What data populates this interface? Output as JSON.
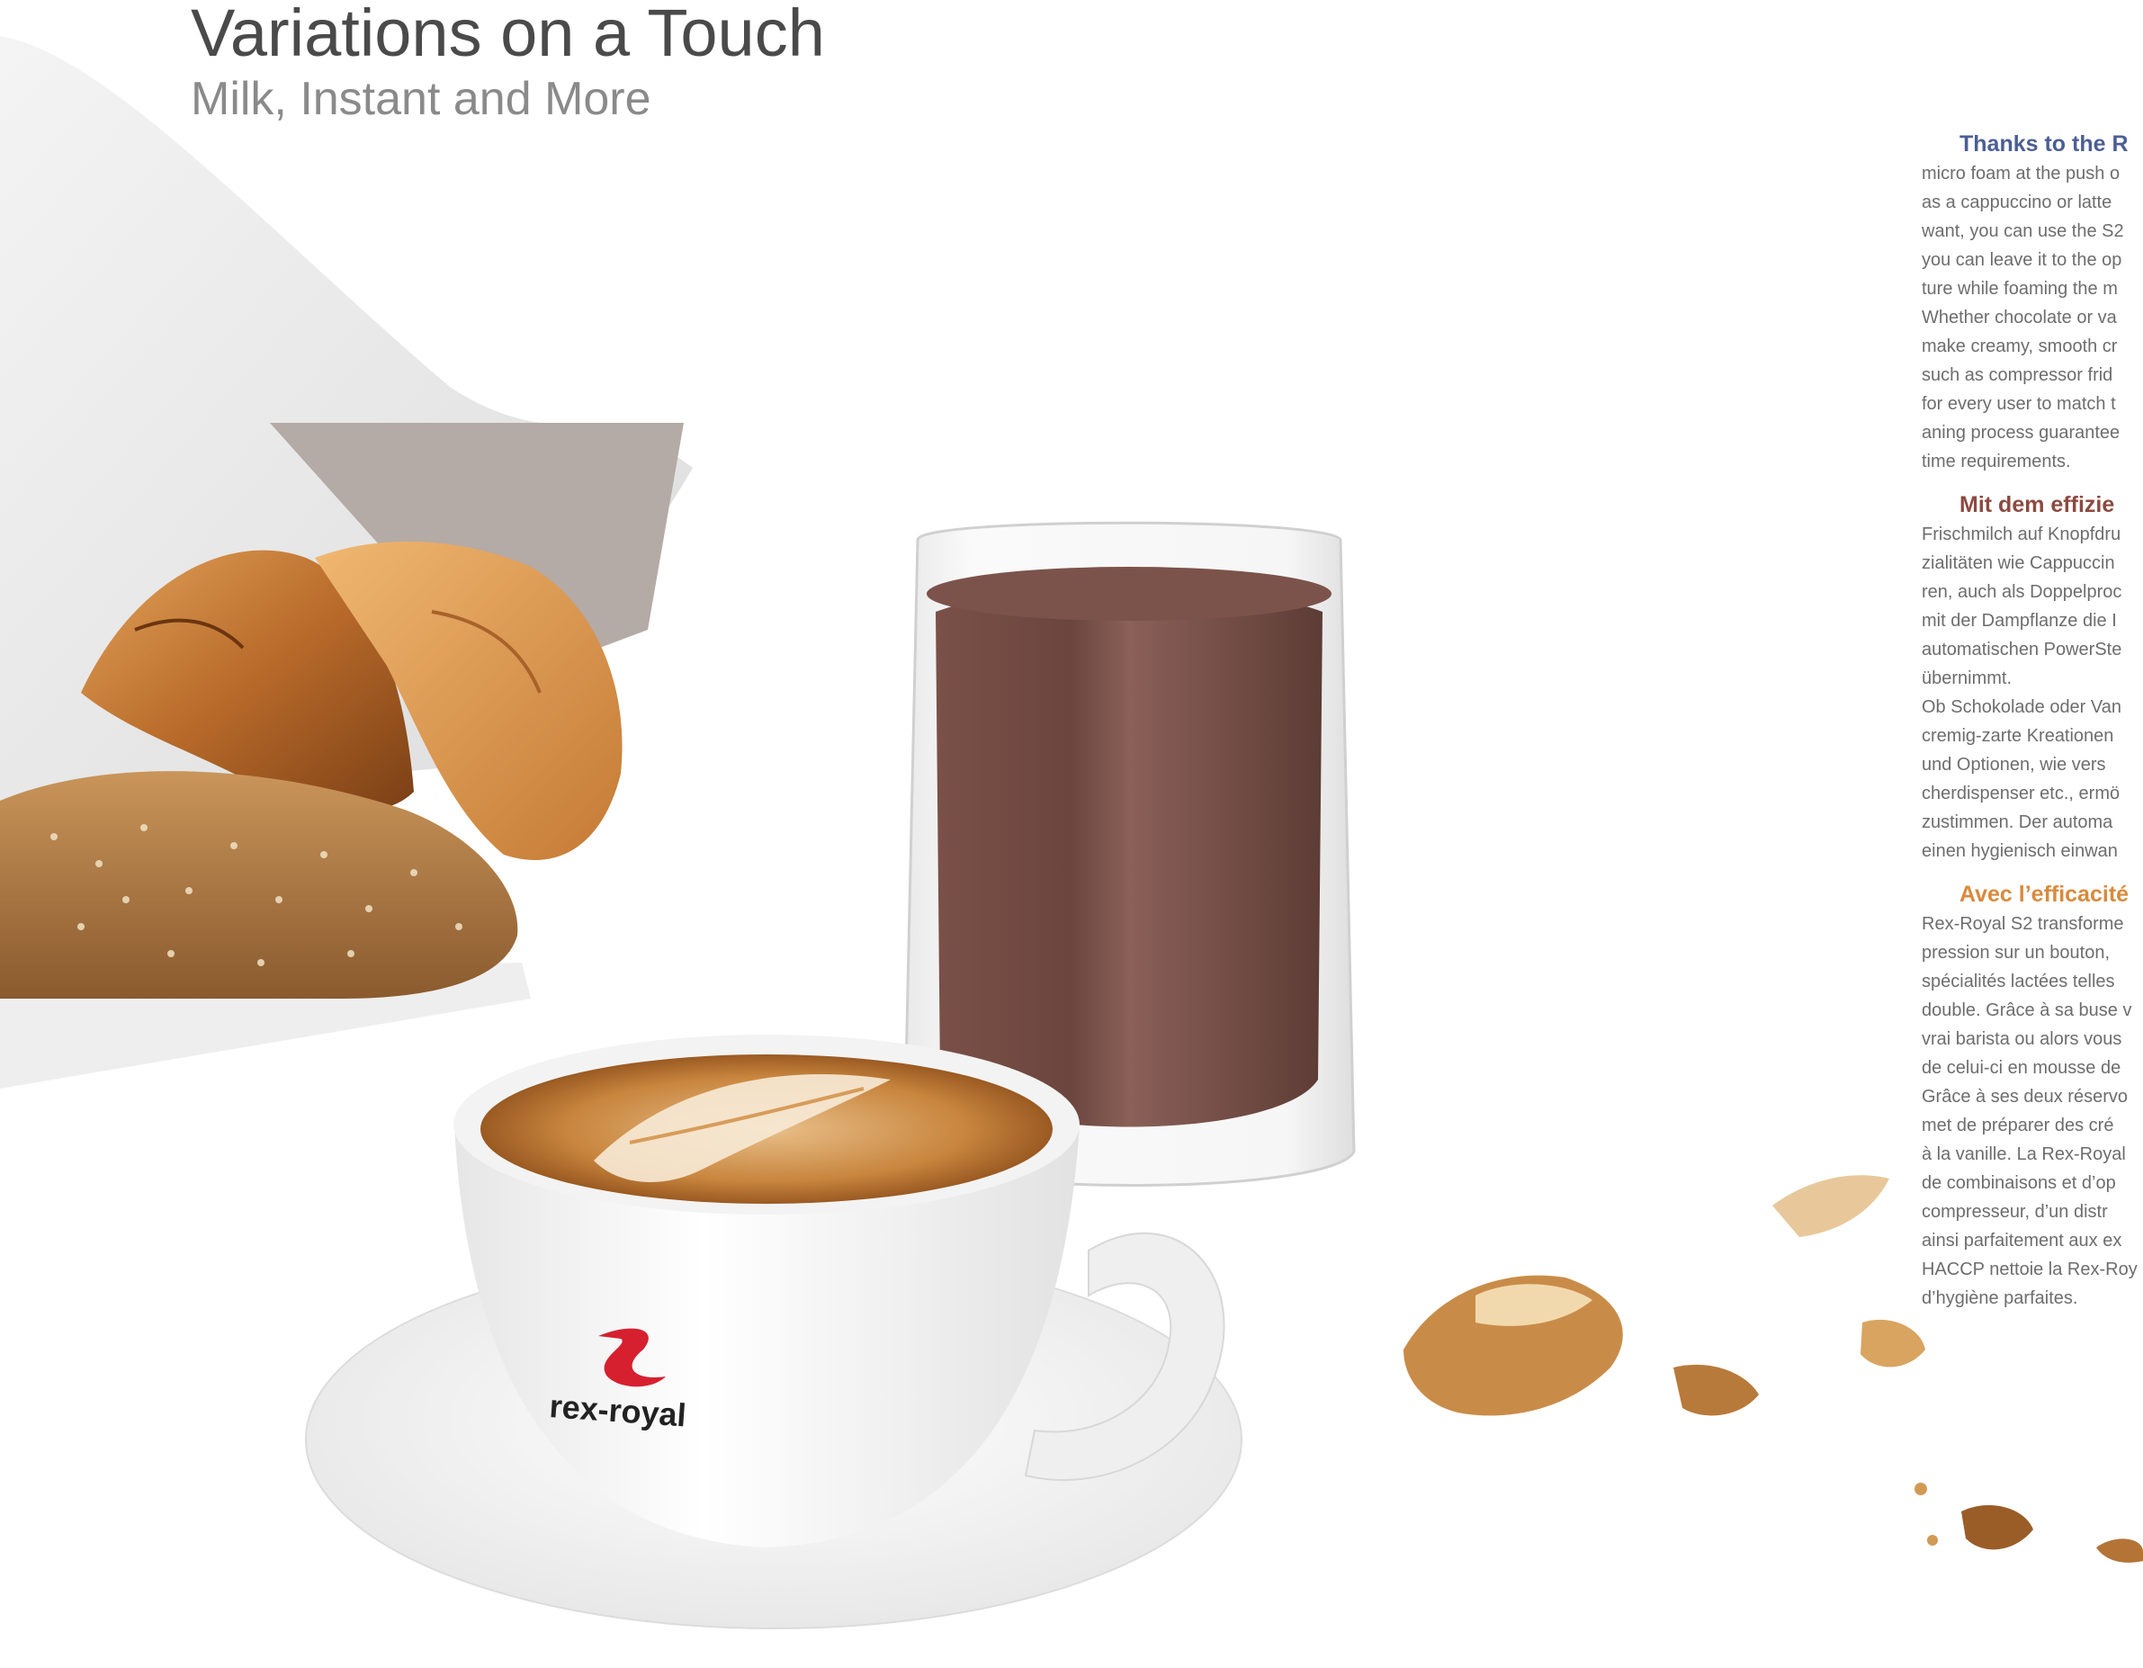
{
  "header": {
    "title": "Variations on a Touch",
    "subtitle": "Milk, Instant and More"
  },
  "colors": {
    "title": "#4a4a4a",
    "subtitle": "#8a8a8a",
    "heading_en": "#4c5f93",
    "heading_de": "#8c4a40",
    "heading_fr": "#d88a3c",
    "body_text": "#6d6d6d",
    "logo_red": "#d62030"
  },
  "photo": {
    "logo_text": "rex-royal"
  },
  "text_column": {
    "english": {
      "heading": "Thanks to the R",
      "lines": [
        "micro foam at the push o",
        "as a cappuccino or latte",
        "want, you can use the S2",
        "you can leave it to the op",
        "ture while foaming the m",
        "Whether chocolate or va",
        "make creamy, smooth cr",
        "such as compressor frid",
        "for every user to match t",
        "aning process guarantee",
        "time requirements."
      ]
    },
    "german": {
      "heading": "Mit dem effizie",
      "lines": [
        "Frischmilch auf Knopfdru",
        "zialitäten wie Cappuccin",
        "ren, auch als Doppelproc",
        "mit der Dampflanze die I",
        "automatischen PowerSte",
        "übernimmt.",
        "Ob Schokolade oder Van",
        "cremig-zarte Kreationen",
        "und Optionen, wie vers",
        "cherdispenser etc., ermö",
        "zustimmen. Der automa",
        "einen hygienisch einwan"
      ]
    },
    "french": {
      "heading": "Avec l’efficacité",
      "lines": [
        "Rex-Royal S2 transforme",
        "pression sur un bouton,",
        "spécialités lactées telles",
        "double. Grâce à sa buse v",
        "vrai barista ou alors vous",
        "de celui-ci en mousse de",
        "Grâce à ses deux réservo",
        "met de préparer des cré",
        "à la vanille. La Rex-Royal",
        "de combinaisons et d’op",
        "compresseur, d’un distr",
        "ainsi parfaitement aux ex",
        "HACCP nettoie la Rex-Roy",
        "d’hygiène parfaites."
      ]
    }
  }
}
